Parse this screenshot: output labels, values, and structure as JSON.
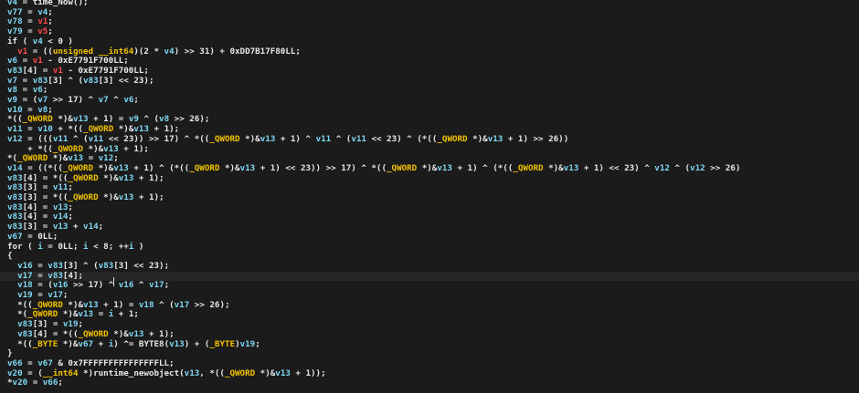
{
  "lines": [
    [
      [
        "v4",
        "v"
      ],
      [
        " = ",
        "n"
      ],
      [
        "time_Now",
        "n"
      ],
      [
        "();",
        "n"
      ]
    ],
    [
      [
        "v77",
        "v"
      ],
      [
        " = ",
        "n"
      ],
      [
        "v4",
        "v"
      ],
      [
        ";",
        "n"
      ]
    ],
    [
      [
        "v78",
        "v"
      ],
      [
        " = ",
        "n"
      ],
      [
        "v1",
        "r"
      ],
      [
        ";",
        "n"
      ]
    ],
    [
      [
        "v79",
        "v"
      ],
      [
        " = ",
        "n"
      ],
      [
        "v5",
        "r"
      ],
      [
        ";",
        "n"
      ]
    ],
    [
      [
        "if ( ",
        "n"
      ],
      [
        "v4",
        "v"
      ],
      [
        " < 0 )",
        "n"
      ]
    ],
    [
      [
        "  ",
        "n"
      ],
      [
        "v1",
        "r"
      ],
      [
        " = ((",
        "n"
      ],
      [
        "unsigned __int64",
        "t"
      ],
      [
        ")(2 * ",
        "n"
      ],
      [
        "v4",
        "v"
      ],
      [
        ") >> 31) + 0xDD7B17F80LL;",
        "n"
      ]
    ],
    [
      [
        "v6",
        "v"
      ],
      [
        " = ",
        "n"
      ],
      [
        "v1",
        "r"
      ],
      [
        " - 0xE7791F700LL;",
        "n"
      ]
    ],
    [
      [
        "v83",
        "v"
      ],
      [
        "[4] = ",
        "n"
      ],
      [
        "v1",
        "r"
      ],
      [
        " - 0xE7791F700LL;",
        "n"
      ]
    ],
    [
      [
        "v7",
        "v"
      ],
      [
        " = ",
        "n"
      ],
      [
        "v83",
        "v"
      ],
      [
        "[3] ^ (",
        "n"
      ],
      [
        "v83",
        "v"
      ],
      [
        "[3] << 23);",
        "n"
      ]
    ],
    [
      [
        "v8",
        "v"
      ],
      [
        " = ",
        "n"
      ],
      [
        "v6",
        "v"
      ],
      [
        ";",
        "n"
      ]
    ],
    [
      [
        "v9",
        "v"
      ],
      [
        " = (",
        "n"
      ],
      [
        "v7",
        "v"
      ],
      [
        " >> 17) ^ ",
        "n"
      ],
      [
        "v7",
        "v"
      ],
      [
        " ^ ",
        "n"
      ],
      [
        "v6",
        "v"
      ],
      [
        ";",
        "n"
      ]
    ],
    [
      [
        "v10",
        "v"
      ],
      [
        " = ",
        "n"
      ],
      [
        "v8",
        "v"
      ],
      [
        ";",
        "n"
      ]
    ],
    [
      [
        "*((",
        "n"
      ],
      [
        "_QWORD",
        "t"
      ],
      [
        " *)&",
        "n"
      ],
      [
        "v13",
        "v"
      ],
      [
        " + 1) = ",
        "n"
      ],
      [
        "v9",
        "v"
      ],
      [
        " ^ (",
        "n"
      ],
      [
        "v8",
        "v"
      ],
      [
        " >> 26);",
        "n"
      ]
    ],
    [
      [
        "v11",
        "v"
      ],
      [
        " = ",
        "n"
      ],
      [
        "v10",
        "v"
      ],
      [
        " + *((",
        "n"
      ],
      [
        "_QWORD",
        "t"
      ],
      [
        " *)&",
        "n"
      ],
      [
        "v13",
        "v"
      ],
      [
        " + 1);",
        "n"
      ]
    ],
    [
      [
        "v12",
        "v"
      ],
      [
        " = (((",
        "n"
      ],
      [
        "v11",
        "v"
      ],
      [
        " ^ (",
        "n"
      ],
      [
        "v11",
        "v"
      ],
      [
        " << 23)) >> 17) ^ *((",
        "n"
      ],
      [
        "_QWORD",
        "t"
      ],
      [
        " *)&",
        "n"
      ],
      [
        "v13",
        "v"
      ],
      [
        " + 1) ^ ",
        "n"
      ],
      [
        "v11",
        "v"
      ],
      [
        " ^ (",
        "n"
      ],
      [
        "v11",
        "v"
      ],
      [
        " << 23) ^ (*((",
        "n"
      ],
      [
        "_QWORD",
        "t"
      ],
      [
        " *)&",
        "n"
      ],
      [
        "v13",
        "v"
      ],
      [
        " + 1) >> 26))",
        "n"
      ]
    ],
    [
      [
        "    + *((",
        "n"
      ],
      [
        "_QWORD",
        "t"
      ],
      [
        " *)&",
        "n"
      ],
      [
        "v13",
        "v"
      ],
      [
        " + 1);",
        "n"
      ]
    ],
    [
      [
        "*(",
        "n"
      ],
      [
        "_QWORD",
        "t"
      ],
      [
        " *)&",
        "n"
      ],
      [
        "v13",
        "v"
      ],
      [
        " = ",
        "n"
      ],
      [
        "v12",
        "v"
      ],
      [
        ";",
        "n"
      ]
    ],
    [
      [
        "v14",
        "v"
      ],
      [
        " = ((*((",
        "n"
      ],
      [
        "_QWORD",
        "t"
      ],
      [
        " *)&",
        "n"
      ],
      [
        "v13",
        "v"
      ],
      [
        " + 1) ^ (*((",
        "n"
      ],
      [
        "_QWORD",
        "t"
      ],
      [
        " *)&",
        "n"
      ],
      [
        "v13",
        "v"
      ],
      [
        " + 1) << 23)) >> 17) ^ *((",
        "n"
      ],
      [
        "_QWORD",
        "t"
      ],
      [
        " *)&",
        "n"
      ],
      [
        "v13",
        "v"
      ],
      [
        " + 1) ^ (*((",
        "n"
      ],
      [
        "_QWORD",
        "t"
      ],
      [
        " *)&",
        "n"
      ],
      [
        "v13",
        "v"
      ],
      [
        " + 1) << 23) ^ ",
        "n"
      ],
      [
        "v12",
        "v"
      ],
      [
        " ^ (",
        "n"
      ],
      [
        "v12",
        "v"
      ],
      [
        " >> 26)",
        "n"
      ]
    ],
    [
      [
        "v83",
        "v"
      ],
      [
        "[4] = *((",
        "n"
      ],
      [
        "_QWORD",
        "t"
      ],
      [
        " *)&",
        "n"
      ],
      [
        "v13",
        "v"
      ],
      [
        " + 1);",
        "n"
      ]
    ],
    [
      [
        "v83",
        "v"
      ],
      [
        "[3] = ",
        "n"
      ],
      [
        "v11",
        "v"
      ],
      [
        ";",
        "n"
      ]
    ],
    [
      [
        "v83",
        "v"
      ],
      [
        "[3] = *((",
        "n"
      ],
      [
        "_QWORD",
        "t"
      ],
      [
        " *)&",
        "n"
      ],
      [
        "v13",
        "v"
      ],
      [
        " + 1);",
        "n"
      ]
    ],
    [
      [
        "v83",
        "v"
      ],
      [
        "[4] = ",
        "n"
      ],
      [
        "v13",
        "v"
      ],
      [
        ";",
        "n"
      ]
    ],
    [
      [
        "v83",
        "v"
      ],
      [
        "[4] = ",
        "n"
      ],
      [
        "v14",
        "v"
      ],
      [
        ";",
        "n"
      ]
    ],
    [
      [
        "v83",
        "v"
      ],
      [
        "[3] = ",
        "n"
      ],
      [
        "v13",
        "v"
      ],
      [
        " + ",
        "n"
      ],
      [
        "v14",
        "v"
      ],
      [
        ";",
        "n"
      ]
    ],
    [
      [
        "v67",
        "v"
      ],
      [
        " = 0LL;",
        "n"
      ]
    ],
    [
      [
        "for ( ",
        "n"
      ],
      [
        "i",
        "v"
      ],
      [
        " = 0LL; ",
        "n"
      ],
      [
        "i",
        "v"
      ],
      [
        " < 8; ++",
        "n"
      ],
      [
        "i",
        "v"
      ],
      [
        " )",
        "n"
      ]
    ],
    [
      [
        "{",
        "n"
      ]
    ],
    [
      [
        "  ",
        "n"
      ],
      [
        "v16",
        "v"
      ],
      [
        " = ",
        "n"
      ],
      [
        "v83",
        "v"
      ],
      [
        "[3] ^ (",
        "n"
      ],
      [
        "v83",
        "v"
      ],
      [
        "[3] << 23);",
        "n"
      ]
    ],
    [
      [
        "  ",
        "n"
      ],
      [
        "v17",
        "v"
      ],
      [
        " = ",
        "n"
      ],
      [
        "v83",
        "v"
      ],
      [
        "[4];",
        "n"
      ]
    ],
    [
      [
        "  ",
        "n"
      ],
      [
        "v18",
        "v"
      ],
      [
        " = (",
        "n"
      ],
      [
        "v16",
        "v"
      ],
      [
        " >> 17) ^ ",
        "n"
      ],
      [
        "v16",
        "v"
      ],
      [
        " ^ ",
        "n"
      ],
      [
        "v17",
        "v"
      ],
      [
        ";",
        "n"
      ]
    ],
    [
      [
        "  ",
        "n"
      ],
      [
        "v19",
        "v"
      ],
      [
        " = ",
        "n"
      ],
      [
        "v17",
        "v"
      ],
      [
        ";",
        "n"
      ]
    ],
    [
      [
        "  *((",
        "n"
      ],
      [
        "_QWORD",
        "t"
      ],
      [
        " *)&",
        "n"
      ],
      [
        "v13",
        "v"
      ],
      [
        " + 1) = ",
        "n"
      ],
      [
        "v18",
        "v"
      ],
      [
        " ^ (",
        "n"
      ],
      [
        "v17",
        "v"
      ],
      [
        " >> 26);",
        "n"
      ]
    ],
    [
      [
        "  *(",
        "n"
      ],
      [
        "_QWORD",
        "t"
      ],
      [
        " *)&",
        "n"
      ],
      [
        "v13",
        "v"
      ],
      [
        " = ",
        "n"
      ],
      [
        "i",
        "v"
      ],
      [
        " + 1;",
        "n"
      ]
    ],
    [
      [
        "  ",
        "n"
      ],
      [
        "v83",
        "v"
      ],
      [
        "[3] = ",
        "n"
      ],
      [
        "v19",
        "v"
      ],
      [
        ";",
        "n"
      ]
    ],
    [
      [
        "  ",
        "n"
      ],
      [
        "v83",
        "v"
      ],
      [
        "[4] = *((",
        "n"
      ],
      [
        "_QWORD",
        "t"
      ],
      [
        " *)&",
        "n"
      ],
      [
        "v13",
        "v"
      ],
      [
        " + 1);",
        "n"
      ]
    ],
    [
      [
        "  *((",
        "n"
      ],
      [
        "_BYTE",
        "t"
      ],
      [
        " *)&",
        "n"
      ],
      [
        "v67",
        "v"
      ],
      [
        " + ",
        "n"
      ],
      [
        "i",
        "v"
      ],
      [
        ") ^= BYTE8(",
        "n"
      ],
      [
        "v13",
        "v"
      ],
      [
        ") + (",
        "n"
      ],
      [
        "_BYTE",
        "t"
      ],
      [
        ")",
        "n"
      ],
      [
        "v19",
        "v"
      ],
      [
        ";",
        "n"
      ]
    ],
    [
      [
        "}",
        "n"
      ]
    ],
    [
      [
        "v66",
        "v"
      ],
      [
        " = ",
        "n"
      ],
      [
        "v67",
        "v"
      ],
      [
        " & 0x7FFFFFFFFFFFFFFFLL;",
        "n"
      ]
    ],
    [
      [
        "v20",
        "v"
      ],
      [
        " = (",
        "n"
      ],
      [
        "__int64",
        "t"
      ],
      [
        " *)runtime_newobject(",
        "n"
      ],
      [
        "v13",
        "v"
      ],
      [
        ", *((",
        "n"
      ],
      [
        "_QWORD",
        "t"
      ],
      [
        " *)&",
        "n"
      ],
      [
        "v13",
        "v"
      ],
      [
        " + 1));",
        "n"
      ]
    ],
    [
      [
        "*",
        "n"
      ],
      [
        "v20",
        "v"
      ],
      [
        " = ",
        "n"
      ],
      [
        "v66",
        "v"
      ],
      [
        ";",
        "n"
      ]
    ]
  ],
  "current_line": 28
}
